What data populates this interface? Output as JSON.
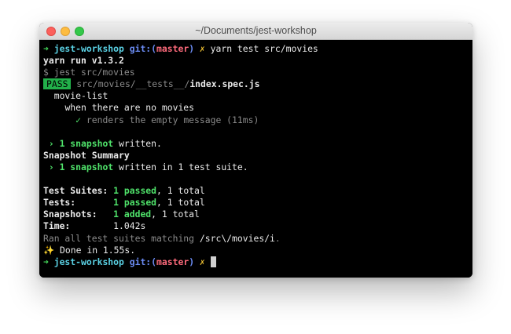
{
  "window": {
    "title": "~/Documents/jest-workshop"
  },
  "prompt": {
    "arrow": "➜",
    "dir": "jest-workshop",
    "git_label": "git:",
    "paren_open": "(",
    "branch": "master",
    "paren_close": ")",
    "dirty": "✗"
  },
  "lines": {
    "command": "yarn test src/movies",
    "yarn_version": "yarn run v1.3.2",
    "jest_cmd": "$ jest src/movies",
    "pass_badge": "PASS",
    "test_path_dir": "src/movies/__tests__/",
    "test_path_file": "index.spec.js",
    "suite": "movie-list",
    "describe": "when there are no movies",
    "check": "✓",
    "test_name": "renders the empty message (11ms)",
    "snap_prefix": "›",
    "snap_count": "1 snapshot",
    "snap_written": "written.",
    "summary_title": "Snapshot Summary",
    "summary_written": "written in 1 test suite.",
    "suites_label": "Test Suites:",
    "suites_passed": "1 passed",
    "suites_total": ", 1 total",
    "tests_label": "Tests:",
    "tests_passed": "1 passed",
    "tests_total": ", 1 total",
    "snaps_label": "Snapshots:",
    "snaps_added": "1 added",
    "snaps_total": ", 1 total",
    "time_label": "Time:",
    "time_value": "1.042s",
    "ran_prefix": "Ran all test suites matching",
    "ran_pattern": "/src\\/movies/i",
    "ran_suffix": ".",
    "done_icon": "✨",
    "done_text": "Done in 1.55s."
  }
}
